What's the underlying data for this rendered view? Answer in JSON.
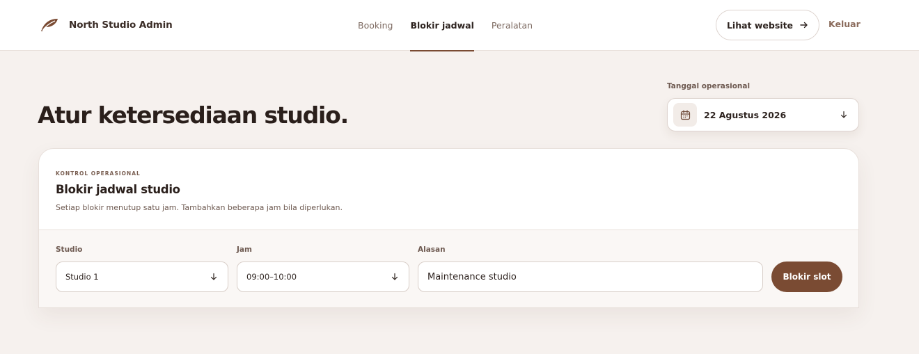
{
  "header": {
    "brand": "North Studio Admin",
    "logo_icon": "leaf-logo-icon",
    "nav": [
      {
        "label": "Booking",
        "active": false
      },
      {
        "label": "Blokir jadwal",
        "active": true
      },
      {
        "label": "Peralatan",
        "active": false
      }
    ],
    "website_button": "Lihat website",
    "website_button_icon": "arrow-right-icon",
    "logout": "Keluar"
  },
  "page": {
    "title": "Atur ketersediaan studio."
  },
  "date_picker": {
    "label": "Tanggal operasional",
    "value": "22 Agustus 2026",
    "icon": "calendar-icon",
    "chevron_icon": "chevron-down-icon"
  },
  "card": {
    "eyebrow": "KONTROL OPERASIONAL",
    "title": "Blokir jadwal studio",
    "subtitle": "Setiap blokir menutup satu jam. Tambahkan beberapa jam bila diperlukan.",
    "form": {
      "studio": {
        "label": "Studio",
        "value": "Studio 1"
      },
      "time": {
        "label": "Jam",
        "value": "09:00–10:00"
      },
      "reason": {
        "label": "Alasan",
        "value": "Maintenance studio"
      },
      "submit": "Blokir slot"
    }
  },
  "colors": {
    "accent": "#7a4b33",
    "background": "#f6f1ee",
    "text": "#2e2420"
  }
}
